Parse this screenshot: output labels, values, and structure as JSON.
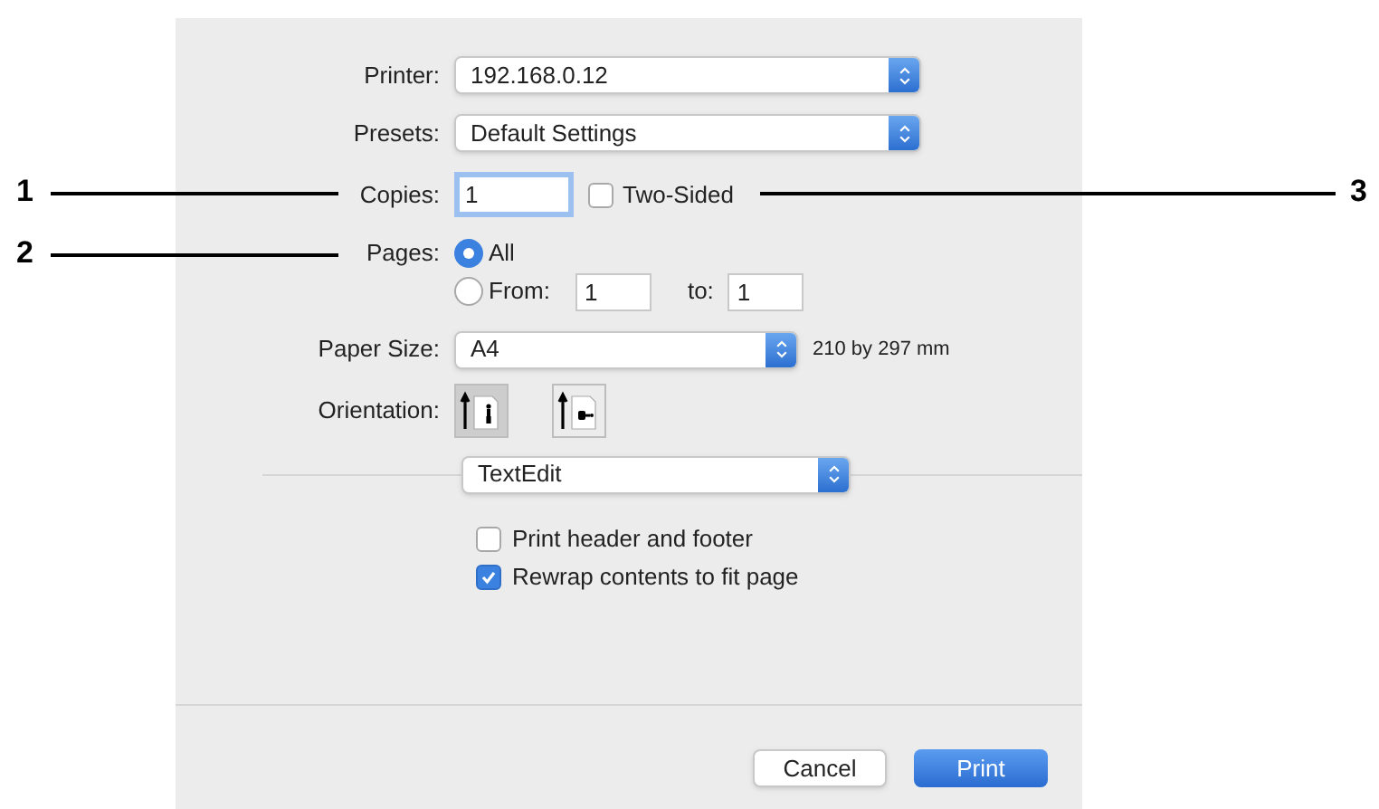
{
  "printer": {
    "label": "Printer:",
    "value": "192.168.0.12"
  },
  "presets": {
    "label": "Presets:",
    "value": "Default Settings"
  },
  "copies": {
    "label": "Copies:",
    "value": "1"
  },
  "two_sided": {
    "label": "Two-Sided",
    "checked": false
  },
  "pages": {
    "label": "Pages:",
    "options": [
      {
        "kind": "all",
        "label": "All",
        "selected": true
      },
      {
        "kind": "range",
        "label": "From:",
        "selected": false,
        "from": "1",
        "to_label": "to:",
        "to": "1"
      }
    ]
  },
  "paper_size": {
    "label": "Paper Size:",
    "value": "A4",
    "dimensions": "210 by 297 mm"
  },
  "orientation": {
    "label": "Orientation:",
    "options": [
      {
        "kind": "portrait",
        "selected": true
      },
      {
        "kind": "landscape",
        "selected": false
      }
    ]
  },
  "app_menu": {
    "value": "TextEdit"
  },
  "options": [
    {
      "label": "Print header and footer",
      "checked": false
    },
    {
      "label": "Rewrap contents to fit page",
      "checked": true
    }
  ],
  "buttons": [
    {
      "kind": "cancel",
      "label": "Cancel"
    },
    {
      "kind": "default",
      "label": "Print"
    }
  ],
  "callouts": [
    {
      "number": "1"
    },
    {
      "number": "2"
    },
    {
      "number": "3"
    }
  ]
}
